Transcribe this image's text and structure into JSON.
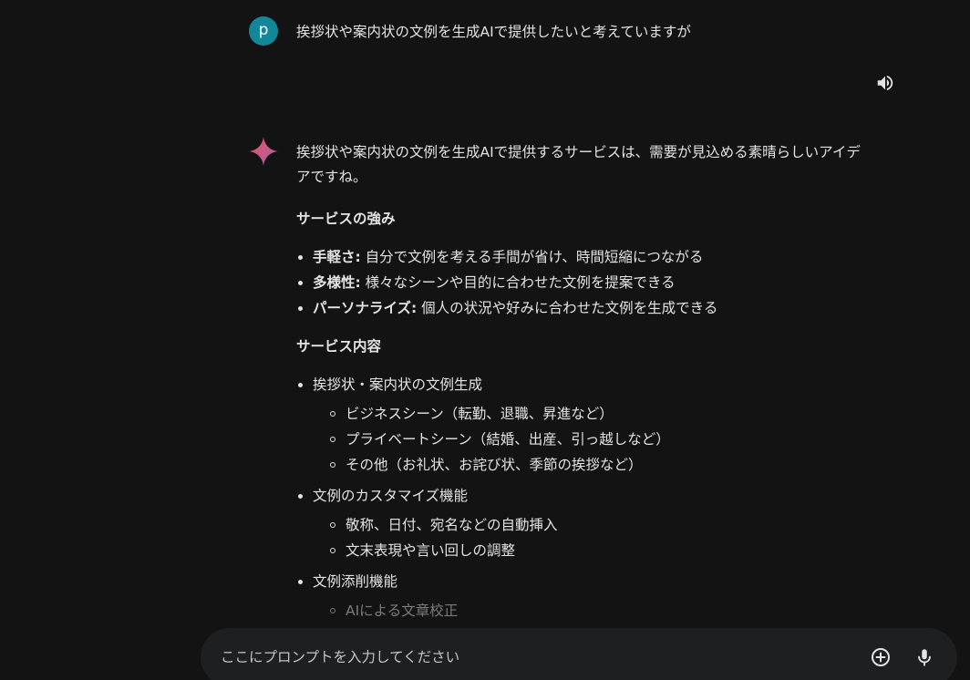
{
  "user": {
    "avatar_letter": "p",
    "prompt": "挨拶状や案内状の文例を生成AIで提供したいと考えていますが"
  },
  "controls": {
    "speaker_icon": "volume-up-icon",
    "add_icon": "plus-circle-icon",
    "mic_icon": "microphone-icon"
  },
  "response": {
    "intro": "挨拶状や案内状の文例を生成AIで提供するサービスは、需要が見込める素晴らしいアイデアですね。",
    "strengths": {
      "title": "サービスの強み",
      "items": [
        {
          "label": "手軽さ:",
          "text": " 自分で文例を考える手間が省け、時間短縮につながる"
        },
        {
          "label": "多様性:",
          "text": " 様々なシーンや目的に合わせた文例を提案できる"
        },
        {
          "label": "パーソナライズ:",
          "text": " 個人の状況や好みに合わせた文例を生成できる"
        }
      ]
    },
    "contents": {
      "title": "サービス内容",
      "items": [
        {
          "text": "挨拶状・案内状の文例生成",
          "sub": [
            "ビジネスシーン（転勤、退職、昇進など）",
            "プライベートシーン（結婚、出産、引っ越しなど）",
            "その他（お礼状、お詫び状、季節の挨拶など）"
          ]
        },
        {
          "text": "文例のカスタマイズ機能",
          "sub": [
            "敬称、日付、宛名などの自動挿入",
            "文末表現や言い回しの調整"
          ]
        },
        {
          "text": "文例添削機能",
          "sub": [
            "AIによる文章校正"
          ]
        }
      ]
    }
  },
  "input": {
    "placeholder": "ここにプロンプトを入力してください"
  },
  "colors": {
    "background": "#131314",
    "input_background": "#1e1f20",
    "avatar": "#12879a",
    "text": "#e3e3e3"
  }
}
